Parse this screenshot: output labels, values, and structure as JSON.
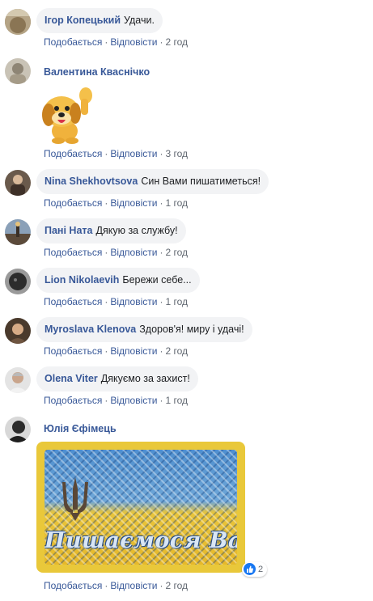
{
  "actions": {
    "like": "Подобається",
    "reply": "Відповісти",
    "separator": "·"
  },
  "comments": [
    {
      "name": "Ігор Копецький",
      "text": "Удачи.",
      "time": "2 год",
      "avatar_color": "#9b8a6a"
    },
    {
      "name": "Валентина Кваснічко",
      "text": "",
      "time": "3 год",
      "avatar_color": "#b9b4a8",
      "sticker": "puppy-waving-sticker"
    },
    {
      "name": "Nina Shekhovtsova",
      "text": "Син Вами пишатиметься!",
      "time": "1 год",
      "avatar_color": "#5a4a3e"
    },
    {
      "name": "Пані Ната",
      "text": "Дякую за службу!",
      "time": "2 год",
      "avatar_color": "#6b5a4a"
    },
    {
      "name": "Lion Nikolaevih",
      "text": "Бережи себе...",
      "time": "1 год",
      "avatar_color": "#2a2a2a"
    },
    {
      "name": "Myroslava Klenova",
      "text": "Здоров'я! миру і удачі!",
      "time": "2 год",
      "avatar_color": "#5d4632"
    },
    {
      "name": "Olena Viter",
      "text": "Дякуємо за захист!",
      "time": "1 год",
      "avatar_color": "#cfcfcf"
    },
    {
      "name": "Юлія Єфімець",
      "text": "",
      "time": "2 год",
      "avatar_color": "#3a3a3a",
      "image_text": "Пишаємося Вами!",
      "reaction_count": "2"
    }
  ],
  "colors": {
    "link": "#385898",
    "meta": "#606770",
    "bubble": "#f2f3f5",
    "like": "#1877f2"
  }
}
